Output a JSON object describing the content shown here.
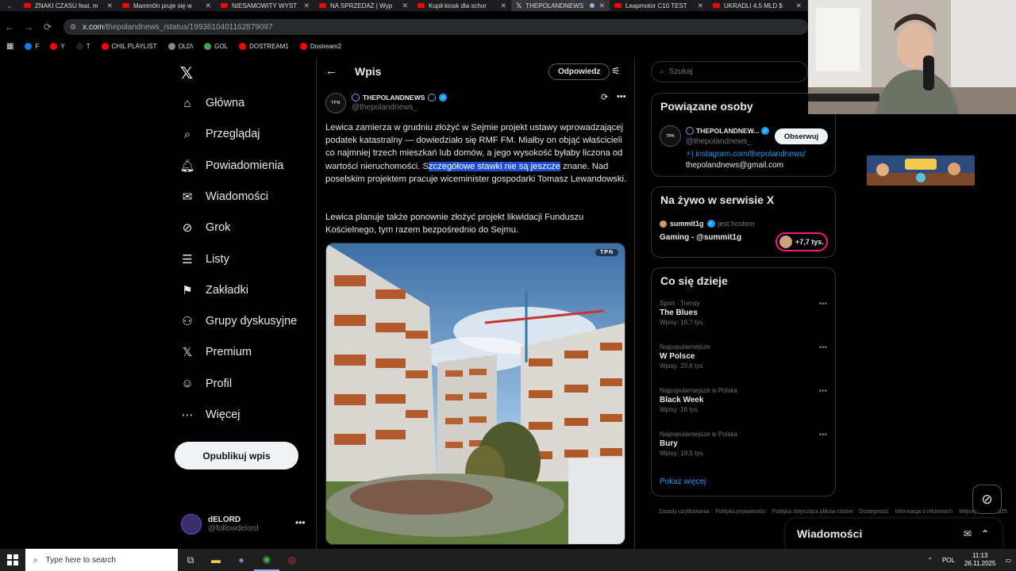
{
  "browser": {
    "tabs": [
      {
        "title": "ZNAKI CZASU feat. m",
        "type": "yt"
      },
      {
        "title": "Mamm0n pruje się w",
        "type": "yt"
      },
      {
        "title": "NIESAMOWITY WYST",
        "type": "yt"
      },
      {
        "title": "NA SPRZEDAŻ | Wyp",
        "type": "yt"
      },
      {
        "title": "Kupił kiosk dla schor",
        "type": "yt"
      },
      {
        "title": "THEPOLANDNEWS",
        "type": "x"
      },
      {
        "title": "Leapmotor C10 TEST",
        "type": "yt"
      },
      {
        "title": "UKRADLI 4,5 MLD $",
        "type": "yt"
      }
    ],
    "url_host": "x.com",
    "url_path": "/thepolandnews_/status/1993610401162879097",
    "bookmarks": [
      "F",
      "Y",
      "T",
      "CHIL PLAYLIST",
      "OLD\\",
      "GOL",
      "DOSTREAM1",
      "Dostream2"
    ]
  },
  "nav": {
    "items": [
      {
        "label": "Główna",
        "icon": "home-icon",
        "glyph": "⌂"
      },
      {
        "label": "Przeglądaj",
        "icon": "search-icon",
        "glyph": "⌕"
      },
      {
        "label": "Powiadomienia",
        "icon": "bell-icon",
        "glyph": "🔔︎"
      },
      {
        "label": "Wiadomości",
        "icon": "mail-icon",
        "glyph": "✉"
      },
      {
        "label": "Grok",
        "icon": "grok-icon",
        "glyph": "⊘"
      },
      {
        "label": "Listy",
        "icon": "list-icon",
        "glyph": "☰"
      },
      {
        "label": "Zakładki",
        "icon": "bookmark-icon",
        "glyph": "⚑"
      },
      {
        "label": "Grupy dyskusyjne",
        "icon": "communities-icon",
        "glyph": "⚇"
      },
      {
        "label": "Premium",
        "icon": "x-logo-icon",
        "glyph": "𝕏"
      },
      {
        "label": "Profil",
        "icon": "profile-icon",
        "glyph": "☺"
      },
      {
        "label": "Więcej",
        "icon": "more-circle-icon",
        "glyph": "⋯"
      }
    ],
    "post_button": "Opublikuj wpis",
    "user_name": "dELORD",
    "user_handle": "@followdelord"
  },
  "main": {
    "title": "Wpis",
    "reply_button": "Odpowiedz",
    "author_name": "THEPOLANDNEWS",
    "author_handle": "@thepolandnews_",
    "avatar_text": "TPN",
    "p1_before": "Lewica zamierza w grudniu złożyć w Sejmie projekt ustawy wprowadzającej podatek katastralny — dowiedziało się RMF FM. Miałby on objąć właścicieli co najmniej trzech mieszkań lub domów, a jego wysokość byłaby liczona od wartości nieruchomości. S",
    "p1_highlight": "zczegółowe stawki nie są jeszcze",
    "p1_after": " znane. Nad poselskim projektem pracuje wiceminister gospodarki Tomasz Lewandowski.",
    "p2": "Lewica planuje także ponownie złożyć projekt likwidacji Funduszu Kościelnego, tym razem bezpośrednio do Sejmu.",
    "media_badge": "TPN"
  },
  "sidebar": {
    "search_placeholder": "Szukaj",
    "related": {
      "title": "Powiązane osoby",
      "name": "THEPOLANDNEW...",
      "handle": "@thepolandnews_",
      "follow": "Obserwuj",
      "bio_link": "⚡| instagram.com/thepolandnews/",
      "bio_email": "thepolandnews@gmail.com",
      "avatar_text": "TPN"
    },
    "live": {
      "title": "Na żywo w serwisie X",
      "user": "summit1g",
      "host_label": "jest hostem",
      "stream": "Gaming - @summit1g",
      "count": "+7,7 tys."
    },
    "trends": {
      "title": "Co się dzieje",
      "items": [
        {
          "context": "Sport · Trendy",
          "name": "The Blues",
          "count": "Wpisy: 16,7 tys."
        },
        {
          "context": "Najpopularniejsze",
          "name": "W Polsce",
          "count": "Wpisy: 20,6 tys."
        },
        {
          "context": "Najpopularniejsze w Polska",
          "name": "Black Week",
          "count": "Wpisy: 16 tys."
        },
        {
          "context": "Najpopularniejsze w Polska",
          "name": "Bury",
          "count": "Wpisy: 19,5 tys."
        }
      ],
      "show_more": "Pokaż więcej"
    },
    "footer": [
      "Zasady użytkowania",
      "Polityka prywatności",
      "Polityka dotycząca plików cookie",
      "Dostępność",
      "Informacja o reklamach",
      "Więcej ···",
      "© 2025"
    ],
    "messages": "Wiadomości"
  },
  "taskbar": {
    "search_placeholder": "Type here to search",
    "lang": "POL",
    "time": "11:13",
    "date": "26.11.2025"
  },
  "colors": {
    "accent": "#1d9bf0",
    "highlight": "#1c4fd6",
    "border": "#2f3336"
  }
}
